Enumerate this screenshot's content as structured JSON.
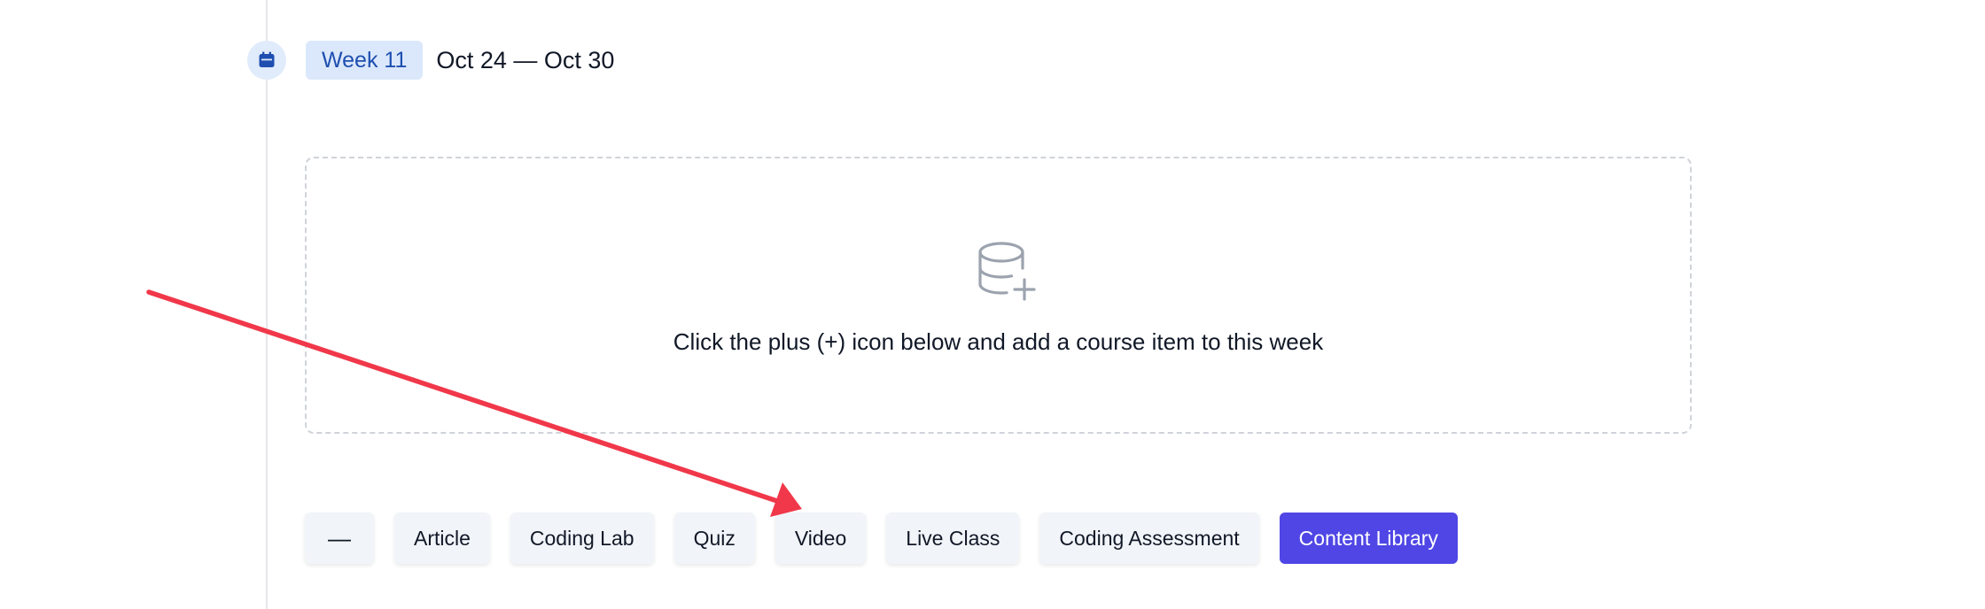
{
  "week": {
    "label": "Week 11",
    "dates": "Oct 24 — Oct 30",
    "icon": "calendar-icon"
  },
  "empty_state": {
    "icon": "database-add-icon",
    "message": "Click the plus (+) icon below and add a course item to this week"
  },
  "actions": {
    "collapse_label": "—",
    "article_label": "Article",
    "coding_lab_label": "Coding Lab",
    "quiz_label": "Quiz",
    "video_label": "Video",
    "live_class_label": "Live Class",
    "coding_assessment_label": "Coding Assessment",
    "content_library_label": "Content Library"
  },
  "colors": {
    "primary": "#4f46e5",
    "week_pill_bg": "#dbe8fb",
    "week_pill_text": "#1e4fb0",
    "annotation_arrow": "#f0384a"
  }
}
